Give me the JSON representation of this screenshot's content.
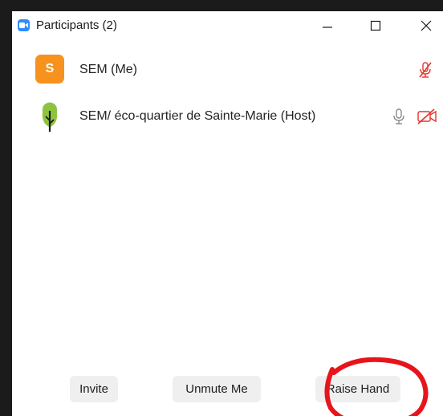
{
  "window": {
    "title": "Participants (2)",
    "controls": {
      "minimize": "minimize",
      "maximize": "maximize",
      "close": "close"
    }
  },
  "participants": [
    {
      "avatar_letter": "S",
      "avatar_color": "#f7921e",
      "name": "SEM (Me)",
      "audio": "muted-mic-icon"
    },
    {
      "avatar_icon": "tree-logo",
      "name": "SEM/ éco-quartier de Sainte-Marie (Host)",
      "audio": "mic-icon",
      "video": "video-off-icon"
    }
  ],
  "footer": {
    "invite_label": "Invite",
    "unmute_label": "Unmute Me",
    "raise_hand_label": "Raise Hand"
  },
  "colors": {
    "zoom_blue": "#2d8cff",
    "muted_red": "#e5342e",
    "annotation_red": "#e8141c",
    "button_bg": "#efefef",
    "backdrop": "#1b1b1b"
  }
}
